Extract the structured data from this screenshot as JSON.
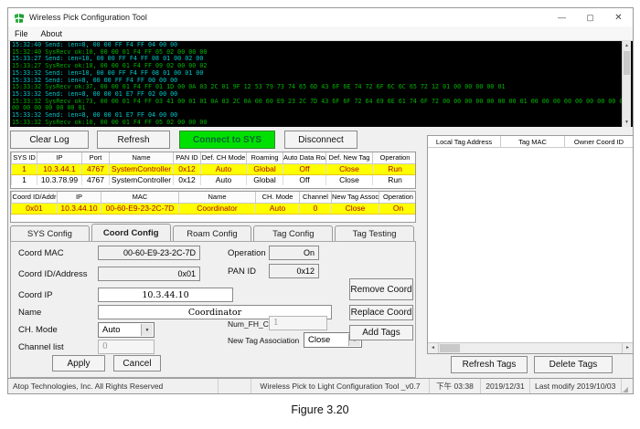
{
  "window": {
    "title": "Wireless Pick Configuration Tool",
    "controls": {
      "minimize": "—",
      "maximize": "▢",
      "close": "✕"
    }
  },
  "menu": {
    "items": [
      "File",
      "About"
    ]
  },
  "log": {
    "lines": [
      {
        "type": "send",
        "text": "15:32:40 Send: len=8, 00 00 FF F4 FF 04 00 00"
      },
      {
        "type": "recv",
        "text": "15:32:40 SysRecv ok:10, 00 00 01 F4 FF 05 02 00 00 00"
      },
      {
        "type": "send",
        "text": "15:33:27 Send: len=10, 00 00 FF F4 FF 08 01 00 02 00"
      },
      {
        "type": "recv",
        "text": "15:33:27 SysRecv ok:10, 00 00 01 F4 FF 09 02 00 00 02"
      },
      {
        "type": "send",
        "text": "15:33:32 Send: len=10, 00 00 FF F4 FF 08 01 00 01 00"
      },
      {
        "type": "send",
        "text": "15:33:32 Send: len=8, 00 00 FF F4 FF 00 00 00"
      },
      {
        "type": "recv",
        "text": "15:33:32 SysRecv ok:37, 00 00 01 F4 FF 01 1D 00 0A 03 2C 01 9F 12 53 79 73 74 65 6D 43 6F 6E 74 72 6F 6C 6C 65 72 12 01 00 00 00 00 01"
      },
      {
        "type": "send",
        "text": "15:33:32 Send: len=8, 00 00 01 E7 FF 02 00 00"
      },
      {
        "type": "recv",
        "text": "15:33:32 SysRecv ok:73, 00 00 01 F4 FF 03 41 00 01 01 0A 03 2C 0A 00 60 E9 23 2C 7D 43 6F 6F 72 64 69 6E 61 74 6F 72 00 00 00 00 00 00 00 01 00 00 00 00 00 00 00 00 00 00 00 00 00 00 00 00 00 00 00 00 00 00 00 00 00 00 00 00 00 00 00 00 00 00 00 00 00 00 00 00 00 00 00 00 00 00 00 00"
      },
      {
        "type": "recv",
        "text": "00 00 00 00 00 00 01"
      },
      {
        "type": "send",
        "text": "15:33:32 Send: len=8, 00 00 01 E7 FF 04 00 00"
      },
      {
        "type": "recv",
        "text": "15:33:32 SysRecv ok:10, 00 00 01 F4 FF 05 02 00 00 00"
      }
    ]
  },
  "toolbar": {
    "clear_log": "Clear Log",
    "refresh": "Refresh",
    "connect": "Connect to SYS",
    "disconnect": "Disconnect"
  },
  "sys_table": {
    "headers": [
      "SYS ID",
      "IP",
      "Port",
      "Name",
      "PAN ID",
      "Def. CH Mode",
      "Roaming",
      "Auto Data Roam",
      "Def. New Tag",
      "Operation"
    ],
    "rows": [
      [
        "1",
        "10.3.44.1",
        "4767",
        "SystemController",
        "0x12",
        "Auto",
        "Global",
        "Off",
        "Close",
        "Run"
      ],
      [
        "1",
        "10.3.78.99",
        "4767",
        "SystemController",
        "0x12",
        "Auto",
        "Global",
        "Off",
        "Close",
        "Run"
      ]
    ]
  },
  "coord_table": {
    "headers": [
      "Coord ID/Addr",
      "IP",
      "MAC",
      "Name",
      "CH. Mode",
      "Channel",
      "New Tag Assoc",
      "Operation"
    ],
    "rows": [
      [
        "0x01",
        "10.3.44.10",
        "00-60-E9-23-2C-7D",
        "Coordinator",
        "Auto",
        "0",
        "Close",
        "On"
      ]
    ]
  },
  "tabs": {
    "items": [
      "SYS Config",
      "Coord Config",
      "Roam Config",
      "Tag Config",
      "Tag Testing"
    ],
    "active": "Coord Config"
  },
  "form": {
    "labels": {
      "coord_mac": "Coord MAC",
      "coord_id": "Coord ID/Address",
      "coord_ip": "Coord IP",
      "name": "Name",
      "ch_mode": "CH. Mode",
      "channel_list": "Channel list",
      "operation": "Operation",
      "pan_id": "PAN ID",
      "num_fh": "Num_FH_Channels",
      "new_tag": "New Tag Association"
    },
    "values": {
      "coord_mac": "00-60-E9-23-2C-7D",
      "coord_id": "0x01",
      "coord_ip": "10.3.44.10",
      "name": "Coordinator",
      "ch_mode": "Auto",
      "channel_list": "0",
      "operation": "On",
      "pan_id": "0x12",
      "num_fh": "1",
      "new_tag": "Close"
    },
    "buttons": {
      "remove": "Remove Coord",
      "replace": "Replace Coord",
      "add_tags": "Add Tags",
      "apply": "Apply",
      "cancel": "Cancel"
    }
  },
  "tag_panel": {
    "headers": [
      "Local Tag Address",
      "Tag MAC",
      "Owner Coord ID"
    ],
    "buttons": {
      "refresh": "Refresh Tags",
      "delete": "Delete Tags"
    }
  },
  "statusbar": {
    "left": "Atop Technologies, Inc. All Rights Reserved",
    "version": "Wireless Pick to Light Configuration Tool _v0.7",
    "time": "下午 03:38",
    "date": "2019/12/31",
    "modified": "Last modify  2019/10/03"
  },
  "caption": "Figure 3.20",
  "colors": {
    "connect_green": "#00e000",
    "highlight_row_bg": "#ffff00",
    "highlight_row_text": "#b00000",
    "log_send": "#00c8c8",
    "log_recv": "#00b400",
    "log_bg": "#000000"
  }
}
